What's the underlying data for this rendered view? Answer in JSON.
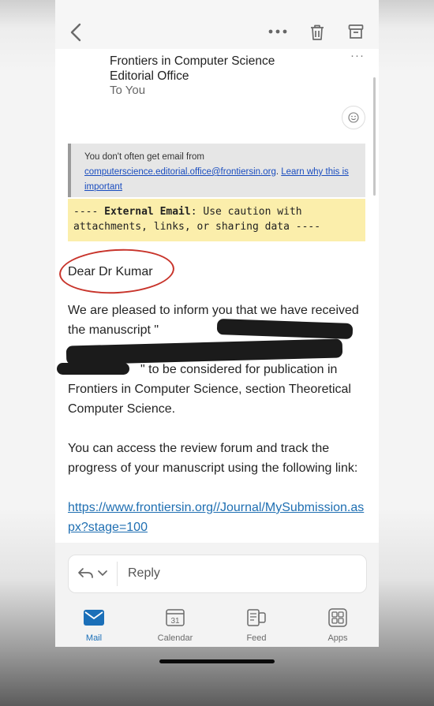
{
  "toolbar": {
    "back": "back",
    "more": "more",
    "delete": "delete",
    "archive": "archive"
  },
  "message": {
    "sender_line1": "Frontiers in Computer Science",
    "sender_line2": "Editorial Office",
    "recipient": "To You",
    "more": "···"
  },
  "notice": {
    "prefix": "You don't often get email from",
    "email": "computerscience.editorial.office@frontiersin.org",
    "link": "Learn why this is important"
  },
  "warning": {
    "prefix": "---- ",
    "bold": "External Email",
    "rest": ": Use caution with attachments, links, or sharing data ----"
  },
  "body": {
    "greeting": "Dear Dr Kumar",
    "para1_start": "We are pleased to inform you that we have received the manuscript \"",
    "para1_end": "\" to be considered for publication in Frontiers in Computer Science, section Theoretical Computer Science.",
    "para2": "You can access the review forum and track the progress of your manuscript using the following link:",
    "link": "https://www.frontiersin.org//Journal/MySubmission.aspx?stage=100"
  },
  "reply": {
    "label": "Reply"
  },
  "tabs": [
    {
      "label": "Mail",
      "icon": "mail-icon",
      "active": true
    },
    {
      "label": "Calendar",
      "icon": "calendar-icon",
      "day": "31"
    },
    {
      "label": "Feed",
      "icon": "feed-icon"
    },
    {
      "label": "Apps",
      "icon": "apps-icon"
    }
  ],
  "colors": {
    "accent": "#1b6fb8",
    "warning_bg": "#fbeeab",
    "circle": "#c8342b"
  }
}
